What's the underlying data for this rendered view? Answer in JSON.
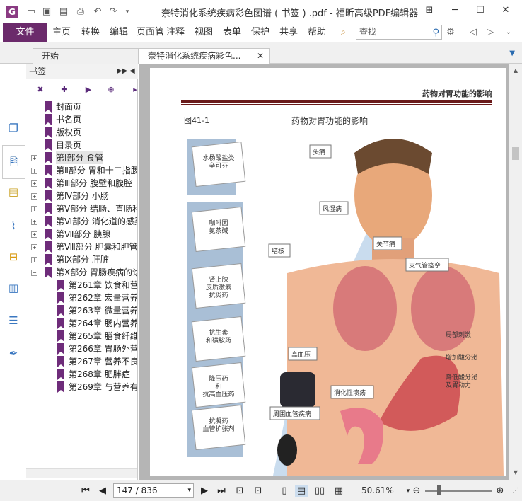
{
  "window": {
    "title": "奈特消化系统疾病彩色图谱 ( 书签 ) .pdf - 福昕高级PDF编辑器",
    "app_logo": "G"
  },
  "quick_access": [
    "open-icon",
    "save-icon",
    "save-as-icon",
    "print-icon",
    "undo-icon",
    "redo-icon",
    "customize-icon"
  ],
  "ribbon": {
    "file_label": "文件",
    "menus": [
      "主页",
      "转换",
      "编辑",
      "页面管理",
      "注释",
      "视图",
      "表单",
      "保护",
      "共享",
      "帮助"
    ],
    "search_placeholder": "查找"
  },
  "tabs": [
    {
      "label": "开始"
    },
    {
      "label": "奈特消化系统疾病彩色..."
    }
  ],
  "bookmarks": {
    "header": "书签",
    "tools": [
      "delete-bookmark-icon",
      "add-bookmark-icon",
      "expand-bookmark-icon",
      "add-child-bookmark-icon",
      "add-page-icon",
      "bookmark-options-icon"
    ],
    "items": [
      {
        "label": "封面页",
        "level": 0,
        "expander": ""
      },
      {
        "label": "书名页",
        "level": 0,
        "expander": ""
      },
      {
        "label": "版权页",
        "level": 0,
        "expander": ""
      },
      {
        "label": "目录页",
        "level": 0,
        "expander": ""
      },
      {
        "label": "第Ⅰ部分 食管",
        "level": 0,
        "expander": "+"
      },
      {
        "label": "第Ⅱ部分 胃和十二指肠",
        "level": 0,
        "expander": "+"
      },
      {
        "label": "第Ⅲ部分 腹壁和腹腔",
        "level": 0,
        "expander": "+"
      },
      {
        "label": "第Ⅳ部分 小肠",
        "level": 0,
        "expander": "+"
      },
      {
        "label": "第Ⅴ部分 结肠、直肠和",
        "level": 0,
        "expander": "+"
      },
      {
        "label": "第Ⅵ部分 消化道的感染",
        "level": 0,
        "expander": "+"
      },
      {
        "label": "第Ⅶ部分 胰腺",
        "level": 0,
        "expander": "+"
      },
      {
        "label": "第Ⅷ部分 胆囊和胆管",
        "level": 0,
        "expander": "+"
      },
      {
        "label": "第Ⅸ部分 肝脏",
        "level": 0,
        "expander": "+"
      },
      {
        "label": "第Ⅹ部分 胃肠疾病的诊",
        "level": 0,
        "expander": "−"
      },
      {
        "label": "第261章 饮食和营",
        "level": 1,
        "expander": ""
      },
      {
        "label": "第262章 宏量营养",
        "level": 1,
        "expander": ""
      },
      {
        "label": "第263章 微量营养",
        "level": 1,
        "expander": ""
      },
      {
        "label": "第264章 肠内营养",
        "level": 1,
        "expander": ""
      },
      {
        "label": "第265章 膳食纤维",
        "level": 1,
        "expander": ""
      },
      {
        "label": "第266章 胃肠外营",
        "level": 1,
        "expander": ""
      },
      {
        "label": "第267章 营养不良",
        "level": 1,
        "expander": ""
      },
      {
        "label": "第268章 肥胖症",
        "level": 1,
        "expander": ""
      },
      {
        "label": "第269章 与营养有",
        "level": 1,
        "expander": ""
      }
    ]
  },
  "sidebar_icons": [
    "pages-icon",
    "layers-icon",
    "comments-icon",
    "attachments-icon",
    "security-icon",
    "content-icon",
    "fields-icon",
    "signatures-icon"
  ],
  "document": {
    "header": "药物对胃功能的影响",
    "figure_label": "图41-1",
    "figure_title": "药物对胃功能的影响",
    "cards": [
      "水杨酸盐类\n辛可芬",
      "咖啡因\n氨茶碱",
      "肾上腺\n皮质激素\n抗炎药",
      "抗生素\n和磺胺药",
      "降压药\n和\n抗高血压药",
      "抗凝药\n血管扩张剂"
    ],
    "callouts": [
      "头痛",
      "风湿病",
      "结核",
      "关节痛",
      "支气管痉挛",
      "高血压",
      "消化性溃疡",
      "周围血管疾病",
      "局部刺激",
      "增加酸分泌",
      "降低酸分泌\n及胃动力"
    ]
  },
  "status": {
    "page_value": "147 / 836",
    "zoom": "50.61%"
  },
  "colors": {
    "accent": "#6b2a6b",
    "bookmark_flag": "#6e2c7a",
    "doc_bg": "#b5b5b5",
    "rule": "#6a1a1a"
  }
}
